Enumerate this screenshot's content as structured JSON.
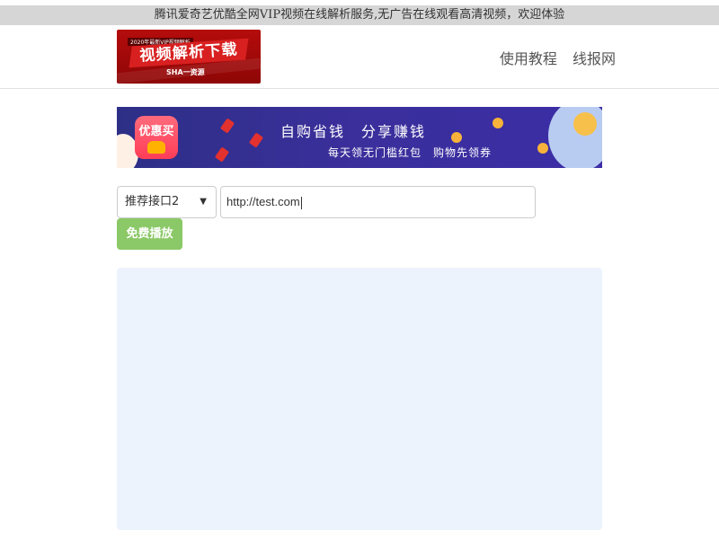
{
  "topbar": {
    "notice": "腾讯爱奇艺优酷全网VIP视频在线解析服务,无广告在线观看高清视频，欢迎体验"
  },
  "header": {
    "logo": {
      "top_text": "2020年最新VIP视频解析",
      "main_text": "视频解析下载",
      "sub_text": "SHA一资源",
      "color": "#b50c0c"
    },
    "nav": [
      {
        "label": "使用教程"
      },
      {
        "label": "线报网"
      }
    ]
  },
  "banner": {
    "app_name": "优惠买",
    "slogan": "自购省钱　分享赚钱",
    "subslogan": "每天领无门槛红包　购物先领券",
    "color": "#2d2f86"
  },
  "form": {
    "api_select": {
      "selected": "推荐接口2",
      "icon": "chevron-down-icon"
    },
    "url_input": {
      "value": "http://test.com"
    },
    "play_button": {
      "label": "免费播放",
      "color": "#8bc867"
    }
  },
  "player": {
    "background": "#ecf3fd"
  }
}
